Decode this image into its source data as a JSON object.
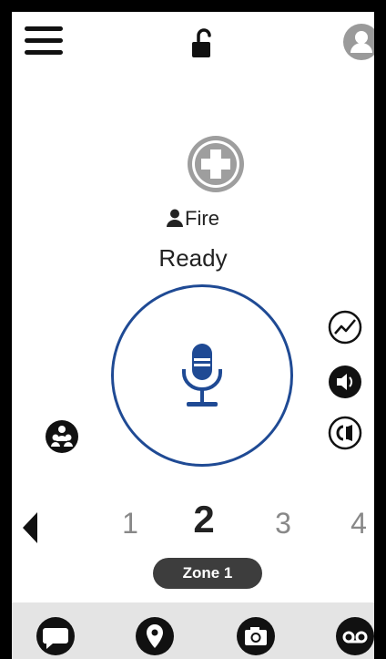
{
  "header": {
    "menu_icon": "hamburger-menu-icon",
    "lock_icon": "unlocked-padlock-icon",
    "avatar_icon": "user-avatar-icon"
  },
  "profile": {
    "icon": "medical-cross-icon",
    "talkgroup": "Fire",
    "status": "Ready"
  },
  "ptt": {
    "icon": "microphone-icon",
    "accent_color": "#1f4a94"
  },
  "side_controls": {
    "scan_icon": "scan-activity-icon",
    "speaker_icon": "speaker-icon",
    "earpiece_icon": "earpiece-icon",
    "group_icon": "group-users-icon"
  },
  "channels": {
    "items": [
      "1",
      "2",
      "3",
      "4"
    ],
    "selected": "2"
  },
  "zone": {
    "label": "Zone 1"
  },
  "bottom_nav": {
    "message_icon": "message-bubble-icon",
    "location_icon": "location-pin-icon",
    "camera_icon": "camera-icon",
    "voicemail_icon": "voicemail-icon"
  }
}
